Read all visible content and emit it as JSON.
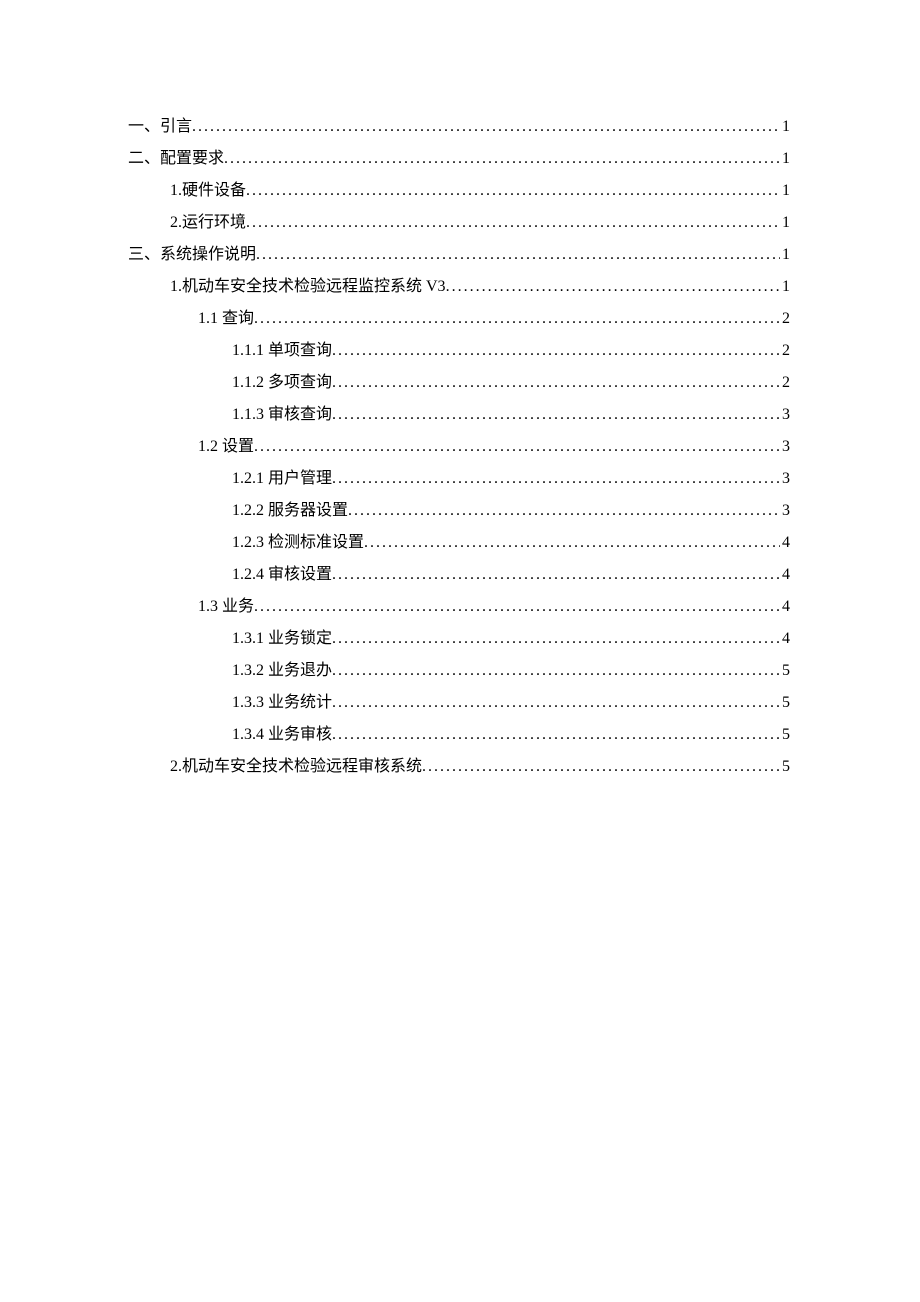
{
  "toc": [
    {
      "title": "一、引言",
      "page": "1",
      "indent": 0
    },
    {
      "title": "二、配置要求",
      "page": "1",
      "indent": 0
    },
    {
      "title": "1.硬件设备",
      "page": "1",
      "indent": 1
    },
    {
      "title": "2.运行环境",
      "page": "1",
      "indent": 1
    },
    {
      "title": "三、系统操作说明",
      "page": "1",
      "indent": 0
    },
    {
      "title": "1.机动车安全技术检验远程监控系统 V3",
      "page": "1",
      "indent": 1
    },
    {
      "title": "1.1 查询",
      "page": "2",
      "indent": 2
    },
    {
      "title": "1.1.1 单项查询",
      "page": "2",
      "indent": 3
    },
    {
      "title": "1.1.2 多项查询",
      "page": "2",
      "indent": 3
    },
    {
      "title": "1.1.3 审核查询",
      "page": "3",
      "indent": 3
    },
    {
      "title": "1.2 设置",
      "page": "3",
      "indent": 2
    },
    {
      "title": "1.2.1 用户管理",
      "page": "3",
      "indent": 3
    },
    {
      "title": "1.2.2 服务器设置",
      "page": "3",
      "indent": 3
    },
    {
      "title": "1.2.3 检测标准设置",
      "page": "4",
      "indent": 3
    },
    {
      "title": "1.2.4 审核设置",
      "page": "4",
      "indent": 3
    },
    {
      "title": "1.3 业务",
      "page": "4",
      "indent": 2
    },
    {
      "title": "1.3.1 业务锁定",
      "page": "4",
      "indent": 3
    },
    {
      "title": "1.3.2 业务退办",
      "page": "5",
      "indent": 3
    },
    {
      "title": "1.3.3 业务统计",
      "page": "5",
      "indent": 3
    },
    {
      "title": "1.3.4 业务审核",
      "page": "5",
      "indent": 3
    },
    {
      "title": "2.机动车安全技术检验远程审核系统",
      "page": "5",
      "indent": 1
    }
  ]
}
